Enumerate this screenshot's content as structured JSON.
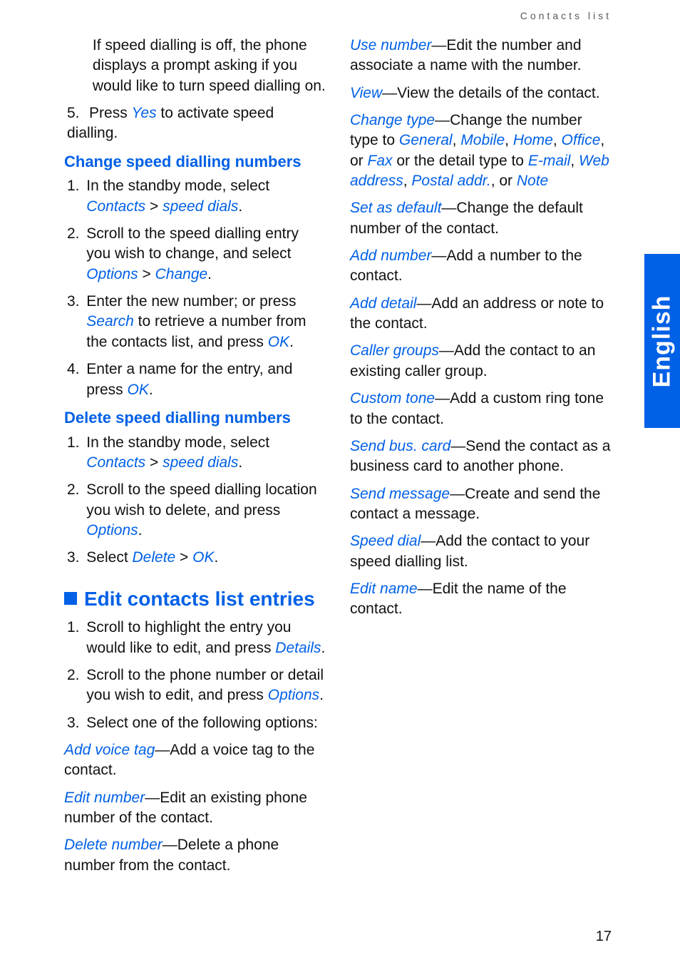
{
  "running_header": "Contacts list",
  "side_tab_label": "English",
  "page_number": "17",
  "intro": {
    "speed_off_paragraph": "If speed dialling is off, the phone displays a prompt asking if you would like to turn speed dialling on.",
    "step5_pre": "Press ",
    "step5_link_yes": "Yes",
    "step5_post": " to activate speed dialling."
  },
  "change_heading": "Change speed dialling numbers",
  "change": {
    "s1_pre": "In the standby mode, select ",
    "s1_link_contacts": "Contacts",
    "s1_gt": " > ",
    "s1_link_speed": "speed dials",
    "s1_end": ".",
    "s2_pre": "Scroll to the speed dialling entry you wish to change, and select ",
    "s2_link_options": "Options",
    "s2_gt": " > ",
    "s2_link_change": "Change",
    "s2_end": ".",
    "s3_pre": "Enter the new number; or press ",
    "s3_link_search": "Search",
    "s3_mid": " to retrieve a number from the contacts list, and press ",
    "s3_link_ok": "OK",
    "s3_end": ".",
    "s4_pre": "Enter a name for the entry, and press ",
    "s4_link_ok": "OK",
    "s4_end": "."
  },
  "delete_heading": "Delete speed dialling numbers",
  "delete": {
    "s1_pre": "In the standby mode, select ",
    "s1_link_contacts": "Contacts",
    "s1_gt": " > ",
    "s1_link_speed": "speed dials",
    "s1_end": ".",
    "s2_pre": "Scroll to the speed dialling location you wish to delete, and press ",
    "s2_link_options": "Options",
    "s2_end": ".",
    "s3_pre": "Select ",
    "s3_link_delete": "Delete",
    "s3_gt": " > ",
    "s3_link_ok": "OK",
    "s3_end": "."
  },
  "edit_heading": "Edit contacts list entries",
  "edit": {
    "s1_pre": "Scroll to highlight the entry you would like to edit, and press ",
    "s1_link_details": "Details",
    "s1_end": ".",
    "s2_pre": "Scroll to the phone number or detail you wish to edit, and press ",
    "s2_link_options": "Options",
    "s2_end": ".",
    "s3": "Select one of the following options:"
  },
  "options": {
    "add_voice_tag_term": "Add voice tag",
    "add_voice_tag_desc": "—Add a voice tag to the contact.",
    "edit_number_term": "Edit number",
    "edit_number_desc": "—Edit an existing phone number of the contact.",
    "delete_number_term": "Delete number",
    "delete_number_desc": "—Delete a phone number from the contact.",
    "use_number_term": "Use number",
    "use_number_desc": "—Edit the number and associate a name with the number.",
    "view_term": "View",
    "view_desc": "—View the details of the contact.",
    "change_type_term": "Change type",
    "change_type_mid1": "—Change the number type to ",
    "ct_general": "General",
    "comma": ", ",
    "ct_mobile": "Mobile",
    "ct_home": "Home",
    "ct_office": "Office",
    "or": ", or ",
    "ct_fax": "Fax",
    "change_type_mid2": " or the detail type to ",
    "ct_email": "E-mail",
    "ct_web": "Web address",
    "ct_postal": "Postal addr.",
    "ct_note": "Note",
    "set_default_term": "Set as default",
    "set_default_desc": "—Change the default number of the contact.",
    "add_number_term": "Add number",
    "add_number_desc": "—Add a number to the contact.",
    "add_detail_term": "Add detail",
    "add_detail_desc": "—Add an address or note to the contact.",
    "caller_groups_term": "Caller groups",
    "caller_groups_desc": "—Add the contact to an existing caller group.",
    "custom_tone_term": "Custom tone",
    "custom_tone_desc": "—Add a custom ring tone to the contact.",
    "send_card_term": "Send bus. card",
    "send_card_desc": "—Send the contact as a business card to another phone.",
    "send_message_term": "Send message",
    "send_message_desc": "—Create and send the contact a message.",
    "speed_dial_term": "Speed dial",
    "speed_dial_desc": "—Add the contact to your speed dialling list.",
    "edit_name_term": "Edit name",
    "edit_name_desc": "—Edit the name of the contact."
  }
}
